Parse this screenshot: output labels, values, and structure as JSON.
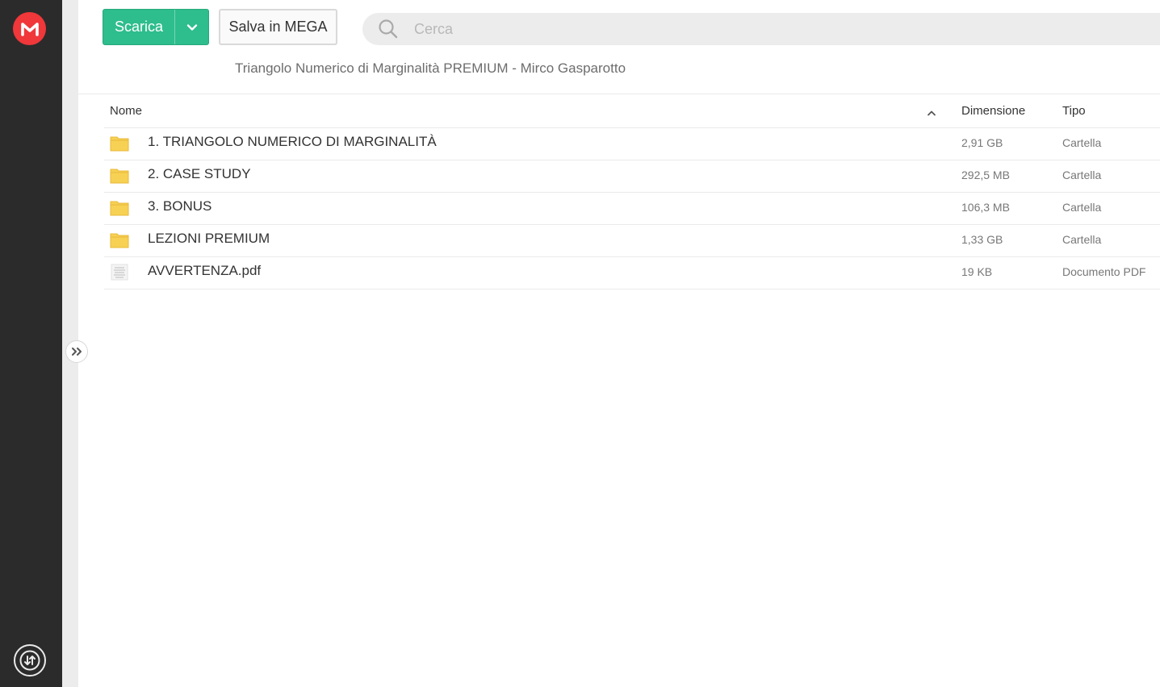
{
  "toolbar": {
    "download_label": "Scarica",
    "save_label": "Salva in MEGA"
  },
  "search": {
    "placeholder": "Cerca"
  },
  "folder_title": "Triangolo Numerico di Marginalità PREMIUM - Mirco Gasparotto",
  "columns": {
    "name": "Nome",
    "size": "Dimensione",
    "type": "Tipo"
  },
  "files": [
    {
      "name": "1. TRIANGOLO NUMERICO DI MARGINALITÀ",
      "size": "2,91 GB",
      "type": "Cartella",
      "icon": "folder-icon"
    },
    {
      "name": "2. CASE STUDY",
      "size": "292,5 MB",
      "type": "Cartella",
      "icon": "folder-icon"
    },
    {
      "name": "3. BONUS",
      "size": "106,3 MB",
      "type": "Cartella",
      "icon": "folder-icon"
    },
    {
      "name": "LEZIONI PREMIUM",
      "size": "1,33 GB",
      "type": "Cartella",
      "icon": "folder-icon"
    },
    {
      "name": "AVVERTENZA.pdf",
      "size": "19 KB",
      "type": "Documento PDF",
      "icon": "pdf-file-icon"
    }
  ],
  "colors": {
    "brand": "#f0373a",
    "primary_button": "#2ebd8d",
    "sidebar": "#2b2b2b",
    "folder": "#f7d154"
  }
}
